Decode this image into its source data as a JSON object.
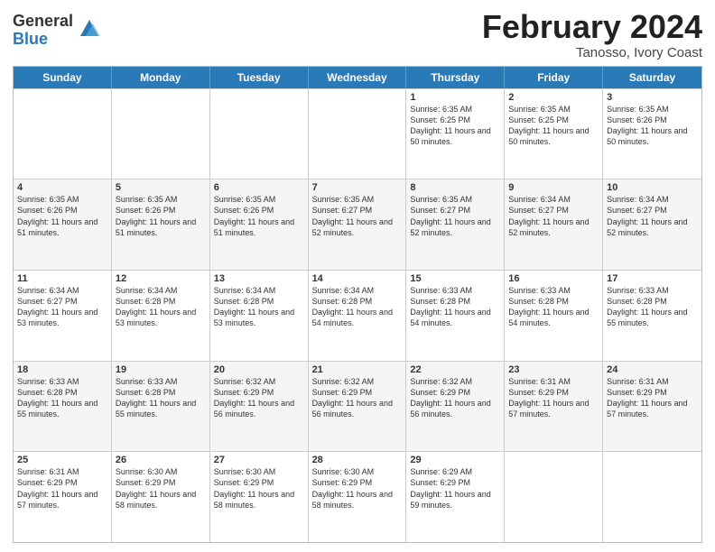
{
  "logo": {
    "general": "General",
    "blue": "Blue"
  },
  "title": "February 2024",
  "subtitle": "Tanosso, Ivory Coast",
  "days": [
    "Sunday",
    "Monday",
    "Tuesday",
    "Wednesday",
    "Thursday",
    "Friday",
    "Saturday"
  ],
  "weeks": [
    [
      {
        "date": "",
        "info": ""
      },
      {
        "date": "",
        "info": ""
      },
      {
        "date": "",
        "info": ""
      },
      {
        "date": "",
        "info": ""
      },
      {
        "date": "1",
        "info": "Sunrise: 6:35 AM\nSunset: 6:25 PM\nDaylight: 11 hours\nand 50 minutes."
      },
      {
        "date": "2",
        "info": "Sunrise: 6:35 AM\nSunset: 6:25 PM\nDaylight: 11 hours\nand 50 minutes."
      },
      {
        "date": "3",
        "info": "Sunrise: 6:35 AM\nSunset: 6:26 PM\nDaylight: 11 hours\nand 50 minutes."
      }
    ],
    [
      {
        "date": "4",
        "info": "Sunrise: 6:35 AM\nSunset: 6:26 PM\nDaylight: 11 hours\nand 51 minutes."
      },
      {
        "date": "5",
        "info": "Sunrise: 6:35 AM\nSunset: 6:26 PM\nDaylight: 11 hours\nand 51 minutes."
      },
      {
        "date": "6",
        "info": "Sunrise: 6:35 AM\nSunset: 6:26 PM\nDaylight: 11 hours\nand 51 minutes."
      },
      {
        "date": "7",
        "info": "Sunrise: 6:35 AM\nSunset: 6:27 PM\nDaylight: 11 hours\nand 52 minutes."
      },
      {
        "date": "8",
        "info": "Sunrise: 6:35 AM\nSunset: 6:27 PM\nDaylight: 11 hours\nand 52 minutes."
      },
      {
        "date": "9",
        "info": "Sunrise: 6:34 AM\nSunset: 6:27 PM\nDaylight: 11 hours\nand 52 minutes."
      },
      {
        "date": "10",
        "info": "Sunrise: 6:34 AM\nSunset: 6:27 PM\nDaylight: 11 hours\nand 52 minutes."
      }
    ],
    [
      {
        "date": "11",
        "info": "Sunrise: 6:34 AM\nSunset: 6:27 PM\nDaylight: 11 hours\nand 53 minutes."
      },
      {
        "date": "12",
        "info": "Sunrise: 6:34 AM\nSunset: 6:28 PM\nDaylight: 11 hours\nand 53 minutes."
      },
      {
        "date": "13",
        "info": "Sunrise: 6:34 AM\nSunset: 6:28 PM\nDaylight: 11 hours\nand 53 minutes."
      },
      {
        "date": "14",
        "info": "Sunrise: 6:34 AM\nSunset: 6:28 PM\nDaylight: 11 hours\nand 54 minutes."
      },
      {
        "date": "15",
        "info": "Sunrise: 6:33 AM\nSunset: 6:28 PM\nDaylight: 11 hours\nand 54 minutes."
      },
      {
        "date": "16",
        "info": "Sunrise: 6:33 AM\nSunset: 6:28 PM\nDaylight: 11 hours\nand 54 minutes."
      },
      {
        "date": "17",
        "info": "Sunrise: 6:33 AM\nSunset: 6:28 PM\nDaylight: 11 hours\nand 55 minutes."
      }
    ],
    [
      {
        "date": "18",
        "info": "Sunrise: 6:33 AM\nSunset: 6:28 PM\nDaylight: 11 hours\nand 55 minutes."
      },
      {
        "date": "19",
        "info": "Sunrise: 6:33 AM\nSunset: 6:28 PM\nDaylight: 11 hours\nand 55 minutes."
      },
      {
        "date": "20",
        "info": "Sunrise: 6:32 AM\nSunset: 6:29 PM\nDaylight: 11 hours\nand 56 minutes."
      },
      {
        "date": "21",
        "info": "Sunrise: 6:32 AM\nSunset: 6:29 PM\nDaylight: 11 hours\nand 56 minutes."
      },
      {
        "date": "22",
        "info": "Sunrise: 6:32 AM\nSunset: 6:29 PM\nDaylight: 11 hours\nand 56 minutes."
      },
      {
        "date": "23",
        "info": "Sunrise: 6:31 AM\nSunset: 6:29 PM\nDaylight: 11 hours\nand 57 minutes."
      },
      {
        "date": "24",
        "info": "Sunrise: 6:31 AM\nSunset: 6:29 PM\nDaylight: 11 hours\nand 57 minutes."
      }
    ],
    [
      {
        "date": "25",
        "info": "Sunrise: 6:31 AM\nSunset: 6:29 PM\nDaylight: 11 hours\nand 57 minutes."
      },
      {
        "date": "26",
        "info": "Sunrise: 6:30 AM\nSunset: 6:29 PM\nDaylight: 11 hours\nand 58 minutes."
      },
      {
        "date": "27",
        "info": "Sunrise: 6:30 AM\nSunset: 6:29 PM\nDaylight: 11 hours\nand 58 minutes."
      },
      {
        "date": "28",
        "info": "Sunrise: 6:30 AM\nSunset: 6:29 PM\nDaylight: 11 hours\nand 58 minutes."
      },
      {
        "date": "29",
        "info": "Sunrise: 6:29 AM\nSunset: 6:29 PM\nDaylight: 11 hours\nand 59 minutes."
      },
      {
        "date": "",
        "info": ""
      },
      {
        "date": "",
        "info": ""
      }
    ]
  ]
}
